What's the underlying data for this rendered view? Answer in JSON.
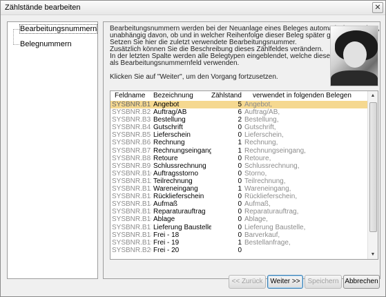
{
  "window": {
    "title": "Zählstände bearbeiten",
    "close_glyph": "✕"
  },
  "tree": {
    "items": [
      {
        "label": "Bearbeitungsnummern"
      },
      {
        "label": "Belegnummern"
      }
    ]
  },
  "description": {
    "lines": [
      "Bearbeitungsnummern werden bei der Neuanlage eines Beleges automatisch vergeben,",
      "unabhängig davon, ob und in welcher Reihenfolge dieser Beleg später gebucht wird.",
      "Setzen Sie hier die zuletzt verwendete Bearbeitungsnummer.",
      "Zusätzlich können Sie die Beschreibung dieses Zählfeldes verändern.",
      "In der letzten Spalte werden alle Belegtypen eingeblendet, welche dieses Feld",
      "als Bearbeitungsnummernfeld verwenden."
    ],
    "hint": "Klicken Sie auf \"Weiter\", um den Vorgang fortzusetzen."
  },
  "table": {
    "columns": {
      "feldname": "Feldname",
      "bezeichnung": "Bezeichnung",
      "zaehlstand": "Zählstand",
      "belege": "verwendet in folgenden Belegen"
    },
    "rows": [
      {
        "feld": "SYSBNR.B1",
        "bez": "Angebot",
        "zahl": "5",
        "bel": "Angebot,",
        "selected": true
      },
      {
        "feld": "SYSBNR.B2",
        "bez": "Auftrag/AB",
        "zahl": "6",
        "bel": "Auftrag/AB,"
      },
      {
        "feld": "SYSBNR.B3",
        "bez": "Bestellung",
        "zahl": "2",
        "bel": "Bestellung,"
      },
      {
        "feld": "SYSBNR.B4",
        "bez": "Gutschrift",
        "zahl": "0",
        "bel": "Gutschrift,"
      },
      {
        "feld": "SYSBNR.B5",
        "bez": "Lieferschein",
        "zahl": "0",
        "bel": "Lieferschein,"
      },
      {
        "feld": "SYSBNR.B6",
        "bez": "Rechnung",
        "zahl": "1",
        "bel": "Rechnung,"
      },
      {
        "feld": "SYSBNR.B7",
        "bez": "Rechnungseingang",
        "zahl": "1",
        "bel": "Rechnungseingang,"
      },
      {
        "feld": "SYSBNR.B8",
        "bez": "Retoure",
        "zahl": "0",
        "bel": "Retoure,"
      },
      {
        "feld": "SYSBNR.B9",
        "bez": "Schlussrechnung",
        "zahl": "0",
        "bel": "Schlussrechnung,"
      },
      {
        "feld": "SYSBNR.B10",
        "bez": "Auftragsstorno",
        "zahl": "0",
        "bel": "Storno,"
      },
      {
        "feld": "SYSBNR.B11",
        "bez": "Teilrechnung",
        "zahl": "0",
        "bel": "Teilrechnung,"
      },
      {
        "feld": "SYSBNR.B12",
        "bez": "Wareneingang",
        "zahl": "1",
        "bel": "Wareneingang,"
      },
      {
        "feld": "SYSBNR.B13",
        "bez": "Rücklieferschein",
        "zahl": "0",
        "bel": "Rücklieferschein,"
      },
      {
        "feld": "SYSBNR.B14",
        "bez": "Aufmaß",
        "zahl": "0",
        "bel": "Aufmaß,"
      },
      {
        "feld": "SYSBNR.B15",
        "bez": "Reparaturauftrag",
        "zahl": "0",
        "bel": "Reparaturauftrag,"
      },
      {
        "feld": "SYSBNR.B16",
        "bez": "Ablage",
        "zahl": "0",
        "bel": "Ablage,"
      },
      {
        "feld": "SYSBNR.B17",
        "bez": "Lieferung Baustelle",
        "zahl": "0",
        "bel": "Lieferung Baustelle,"
      },
      {
        "feld": "SYSBNR.B18",
        "bez": "Frei - 18",
        "zahl": "0",
        "bel": "Barverkauf,"
      },
      {
        "feld": "SYSBNR.B19",
        "bez": "Frei - 19",
        "zahl": "1",
        "bel": "Bestellanfrage,"
      },
      {
        "feld": "SYSBNR.B20",
        "bez": "Frei - 20",
        "zahl": "0",
        "bel": ""
      }
    ],
    "scroll_up_glyph": "▲",
    "scroll_down_glyph": "▼"
  },
  "buttons": {
    "back": "<< Zurück",
    "next": "Weiter >>",
    "save": "Speichern",
    "cancel": "Abbrechen"
  },
  "colors": {
    "selected_row": "#f5d890",
    "field_text": "#8c8c8c"
  }
}
